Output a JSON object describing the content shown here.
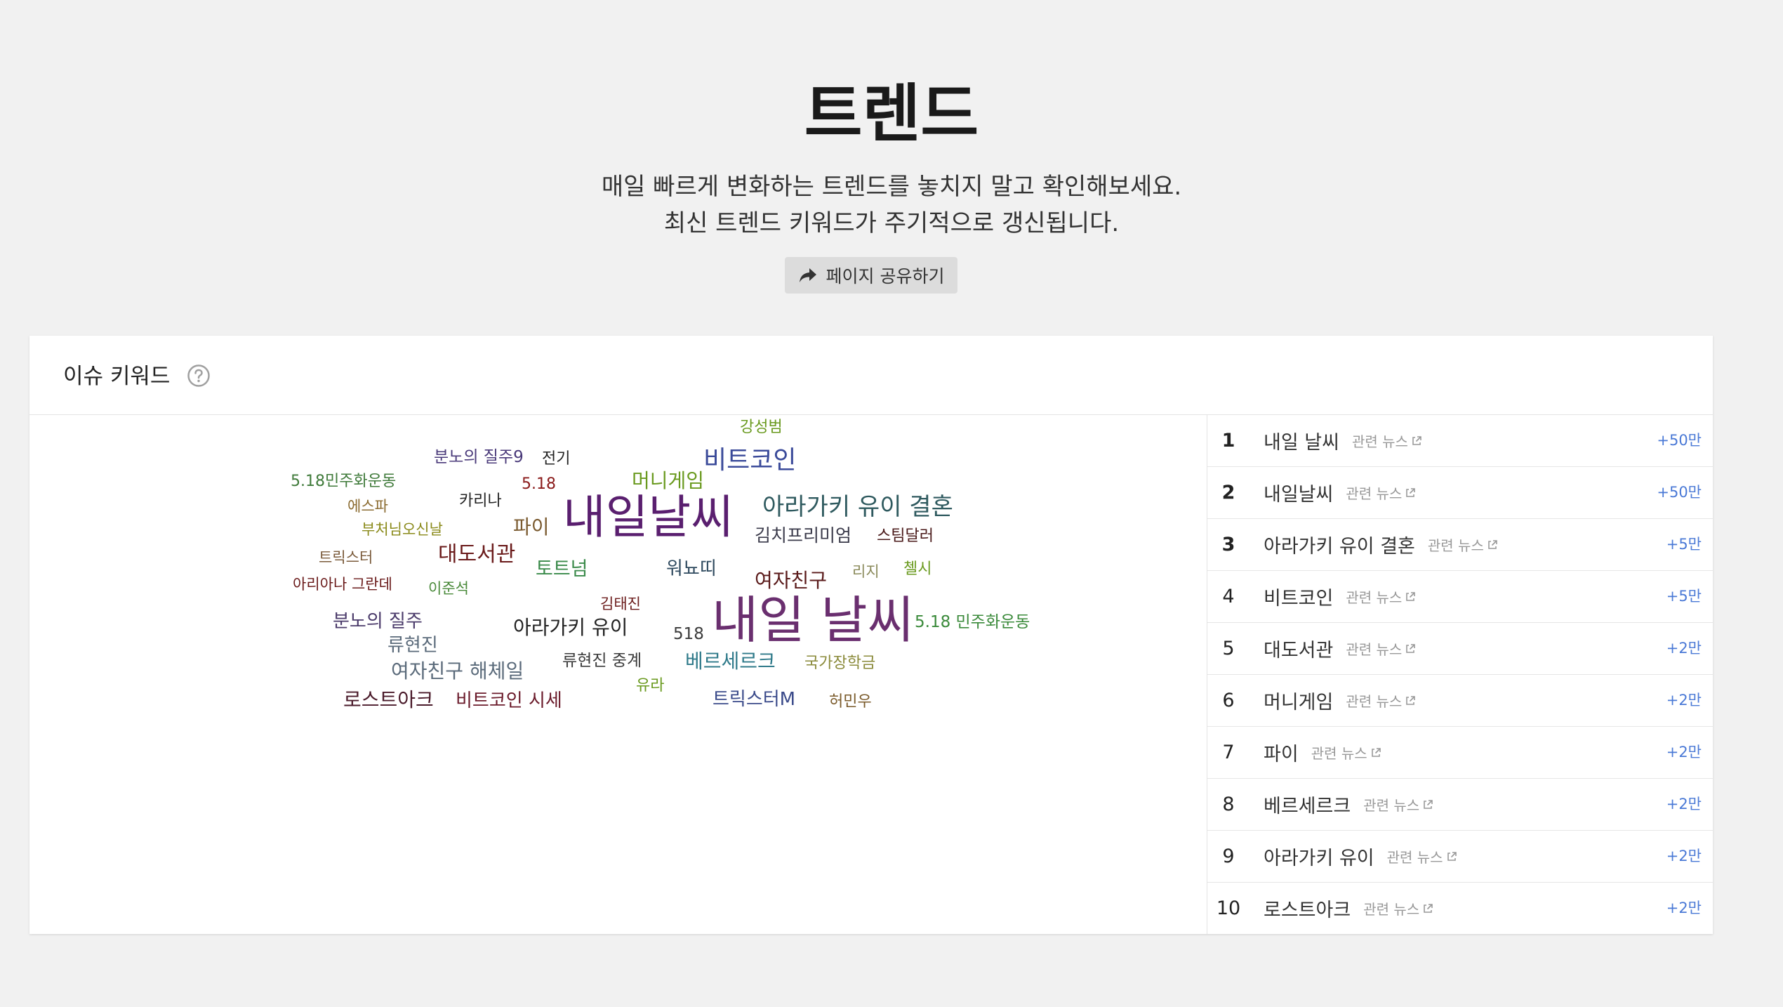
{
  "header": {
    "title": "트렌드",
    "subtitle_line1": "매일 빠르게 변화하는 트렌드를 놓치지 말고 확인해보세요.",
    "subtitle_line2": "최신 트렌드 키워드가 주기적으로 갱신됩니다.",
    "share_label": "페이지 공유하기",
    "share_icon": "share-arrow-icon"
  },
  "issue_section": {
    "title": "이슈 키워드",
    "help_icon": "question-circle-icon"
  },
  "word_cloud": [
    {
      "text": "강성범",
      "color": "#6a9a1f"
    },
    {
      "text": "비트코인",
      "color": "#3b4b9a"
    },
    {
      "text": "분노의 질주9",
      "color": "#4a3a7a"
    },
    {
      "text": "전기",
      "color": "#222222"
    },
    {
      "text": "5.18민주화운동",
      "color": "#3f7a3a"
    },
    {
      "text": "5.18",
      "color": "#8a1a1a"
    },
    {
      "text": "머니게임",
      "color": "#6a9a1f"
    },
    {
      "text": "아라가키 유이 결혼",
      "color": "#2f5a5f"
    },
    {
      "text": "에스파",
      "color": "#8a6a2f"
    },
    {
      "text": "카리나",
      "color": "#222222"
    },
    {
      "text": "내일날씨",
      "color": "#5a1f6f"
    },
    {
      "text": "부처님오신날",
      "color": "#8a8a1a"
    },
    {
      "text": "파이",
      "color": "#7a5a2f"
    },
    {
      "text": "김치프리미엄",
      "color": "#3a3a4a"
    },
    {
      "text": "스팀달러",
      "color": "#4a1a1a"
    },
    {
      "text": "트릭스터",
      "color": "#7a5a3a"
    },
    {
      "text": "대도서관",
      "color": "#6a1a1a"
    },
    {
      "text": "토트넘",
      "color": "#3a8a4a"
    },
    {
      "text": "워뇨띠",
      "color": "#2f4a5f"
    },
    {
      "text": "여자친구",
      "color": "#5a1a1a"
    },
    {
      "text": "리지",
      "color": "#8a8a5a"
    },
    {
      "text": "첼시",
      "color": "#6a9a1f"
    },
    {
      "text": "아리아나 그란데",
      "color": "#6a1a1a"
    },
    {
      "text": "이준석",
      "color": "#4a8a3a"
    },
    {
      "text": "김태진",
      "color": "#6a1a1a"
    },
    {
      "text": "내일 날씨",
      "color": "#6a2f6f"
    },
    {
      "text": "분노의 질주",
      "color": "#4a3a6a"
    },
    {
      "text": "류현진",
      "color": "#5a6a7a"
    },
    {
      "text": "아라가키 유이",
      "color": "#222222"
    },
    {
      "text": "518",
      "color": "#3a3a3a"
    },
    {
      "text": "5.18 민주화운동",
      "color": "#3a8a3a"
    },
    {
      "text": "여자친구 해체일",
      "color": "#5a6a7a"
    },
    {
      "text": "류현진 중계",
      "color": "#3a3a3a"
    },
    {
      "text": "베르세르크",
      "color": "#2f7a8a"
    },
    {
      "text": "국가장학금",
      "color": "#8a8a3a"
    },
    {
      "text": "유라",
      "color": "#6a9a1f"
    },
    {
      "text": "로스트아크",
      "color": "#4a1a2a"
    },
    {
      "text": "비트코인 시세",
      "color": "#6a1a2a"
    },
    {
      "text": "트릭스터M",
      "color": "#3a4a8a"
    },
    {
      "text": "허민우",
      "color": "#7a5a2a"
    }
  ],
  "rankings": [
    {
      "rank": "1",
      "keyword": "내일 날씨",
      "news_label": "관련 뉴스",
      "change": "+50만"
    },
    {
      "rank": "2",
      "keyword": "내일날씨",
      "news_label": "관련 뉴스",
      "change": "+50만"
    },
    {
      "rank": "3",
      "keyword": "아라가키 유이 결혼",
      "news_label": "관련 뉴스",
      "change": "+5만"
    },
    {
      "rank": "4",
      "keyword": "비트코인",
      "news_label": "관련 뉴스",
      "change": "+5만"
    },
    {
      "rank": "5",
      "keyword": "대도서관",
      "news_label": "관련 뉴스",
      "change": "+2만"
    },
    {
      "rank": "6",
      "keyword": "머니게임",
      "news_label": "관련 뉴스",
      "change": "+2만"
    },
    {
      "rank": "7",
      "keyword": "파이",
      "news_label": "관련 뉴스",
      "change": "+2만"
    },
    {
      "rank": "8",
      "keyword": "베르세르크",
      "news_label": "관련 뉴스",
      "change": "+2만"
    },
    {
      "rank": "9",
      "keyword": "아라가키 유이",
      "news_label": "관련 뉴스",
      "change": "+2만"
    },
    {
      "rank": "10",
      "keyword": "로스트아크",
      "news_label": "관련 뉴스",
      "change": "+2만"
    }
  ],
  "colors": {
    "background": "#f1f1f1",
    "card": "#ffffff",
    "delta": "#4a79d6",
    "news_label": "#999999"
  }
}
